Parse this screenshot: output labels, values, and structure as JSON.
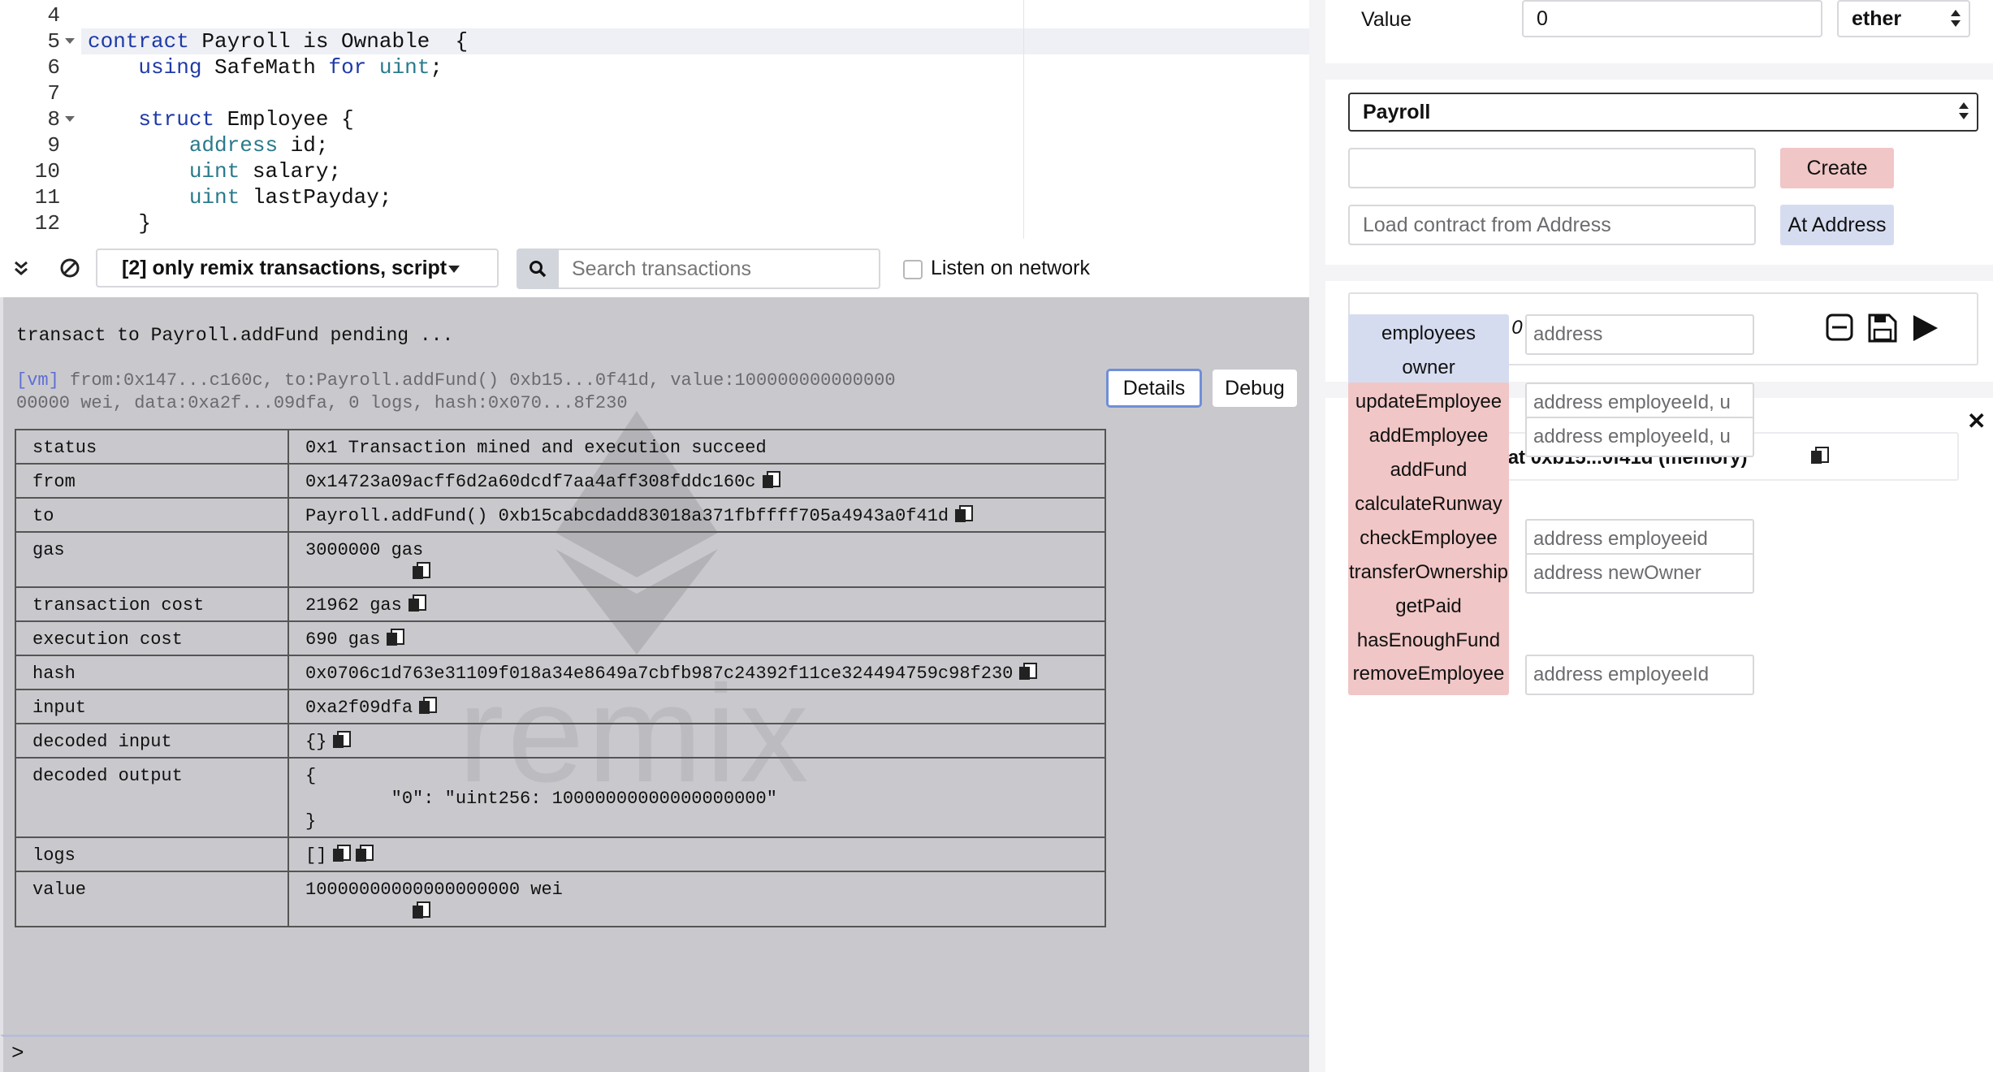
{
  "editor": {
    "lines": [
      {
        "n": "4",
        "parts": [
          {
            "t": "",
            "c": ""
          }
        ]
      },
      {
        "n": "5",
        "fold": true,
        "parts": [
          {
            "t": "contract",
            "c": "kw"
          },
          {
            "t": " Payroll is Ownable  {",
            "c": ""
          }
        ]
      },
      {
        "n": "6",
        "parts": [
          {
            "t": "    ",
            "c": ""
          },
          {
            "t": "using",
            "c": "kw"
          },
          {
            "t": " SafeMath ",
            "c": ""
          },
          {
            "t": "for",
            "c": "kw"
          },
          {
            "t": " ",
            "c": ""
          },
          {
            "t": "uint",
            "c": "ty"
          },
          {
            "t": ";",
            "c": ""
          }
        ]
      },
      {
        "n": "7",
        "parts": [
          {
            "t": "",
            "c": ""
          }
        ]
      },
      {
        "n": "8",
        "fold": true,
        "parts": [
          {
            "t": "    ",
            "c": ""
          },
          {
            "t": "struct",
            "c": "kw"
          },
          {
            "t": " Employee {",
            "c": ""
          }
        ]
      },
      {
        "n": "9",
        "parts": [
          {
            "t": "        ",
            "c": ""
          },
          {
            "t": "address",
            "c": "ty"
          },
          {
            "t": " id;",
            "c": ""
          }
        ]
      },
      {
        "n": "10",
        "parts": [
          {
            "t": "        ",
            "c": ""
          },
          {
            "t": "uint",
            "c": "ty"
          },
          {
            "t": " salary;",
            "c": ""
          }
        ]
      },
      {
        "n": "11",
        "parts": [
          {
            "t": "        ",
            "c": ""
          },
          {
            "t": "uint",
            "c": "ty"
          },
          {
            "t": " lastPayday;",
            "c": ""
          }
        ]
      },
      {
        "n": "12",
        "parts": [
          {
            "t": "    }",
            "c": ""
          }
        ]
      }
    ]
  },
  "terminal": {
    "filter_label": "[2] only remix transactions, script",
    "search_placeholder": "Search transactions",
    "listen_label": "Listen on network",
    "pending_message": "transact to Payroll.addFund pending ...",
    "vm_tag": "[vm]",
    "vm_line1": " from:0x147...c160c, to:Payroll.addFund() 0xb15...0f41d, value:100000000000000",
    "vm_line2": "00000 wei, data:0xa2f...09dfa, 0 logs, hash:0x070...8f230",
    "details_label": "Details",
    "debug_label": "Debug",
    "prompt": ">",
    "watermark": "remix",
    "rows": [
      {
        "key": "status",
        "value": "0x1 Transaction mined and execution succeed"
      },
      {
        "key": "from",
        "value": "0x14723a09acff6d2a60dcdf7aa4aff308fddc160c"
      },
      {
        "key": "to",
        "value": "Payroll.addFund() 0xb15cabcdadd83018a371fbffff705a4943a0f41d"
      },
      {
        "key": "gas",
        "value": "3000000 gas"
      },
      {
        "key": "transaction cost",
        "value": "21962 gas"
      },
      {
        "key": "execution cost",
        "value": "690 gas"
      },
      {
        "key": "hash",
        "value": "0x0706c1d763e31109f018a34e8649a7cbfb987c24392f11ce324494759c98f230"
      },
      {
        "key": "input",
        "value": "0xa2f09dfa"
      },
      {
        "key": "decoded input",
        "value": "{}"
      },
      {
        "key": "decoded output",
        "value_lines": [
          "{",
          "        \"0\": \"uint256: 10000000000000000000\"",
          "}"
        ]
      },
      {
        "key": "logs",
        "value": "[]"
      },
      {
        "key": "value",
        "value": "10000000000000000000 wei"
      }
    ]
  },
  "run": {
    "value_label": "Value",
    "value_amount": "0",
    "value_unit": "ether",
    "contract_name": "Payroll",
    "create_label": "Create",
    "load_placeholder": "Load contract from Address",
    "at_address_label": "At Address",
    "pending_text": "0 pending transactions",
    "instance_title": "Payroll at 0xb15...0f41d (memory)",
    "functions": [
      {
        "label": "employees",
        "kind": "blue",
        "placeholder": "address"
      },
      {
        "label": "owner",
        "kind": "blue",
        "placeholder": ""
      },
      {
        "label": "updateEmployee",
        "kind": "red",
        "placeholder": "address employeeId, u"
      },
      {
        "label": "addEmployee",
        "kind": "red",
        "placeholder": "address employeeId, u"
      },
      {
        "label": "addFund",
        "kind": "red",
        "placeholder": ""
      },
      {
        "label": "calculateRunway",
        "kind": "red",
        "placeholder": ""
      },
      {
        "label": "checkEmployee",
        "kind": "red",
        "placeholder": "address employeeid"
      },
      {
        "label": "transferOwnership",
        "kind": "red",
        "placeholder": "address newOwner"
      },
      {
        "label": "getPaid",
        "kind": "red",
        "placeholder": ""
      },
      {
        "label": "hasEnoughFund",
        "kind": "red",
        "placeholder": ""
      },
      {
        "label": "removeEmployee",
        "kind": "red",
        "placeholder": "address employeeId"
      }
    ]
  },
  "icons": {
    "collapse": "double-chevron-down-icon",
    "clear": "clear-circle-slash-icon",
    "search": "magnifier-icon",
    "copy": "clipboard-copy-icon",
    "pending_clear": "minus-box-icon",
    "pending_save": "floppy-disk-icon",
    "pending_play": "play-triangle-icon"
  }
}
